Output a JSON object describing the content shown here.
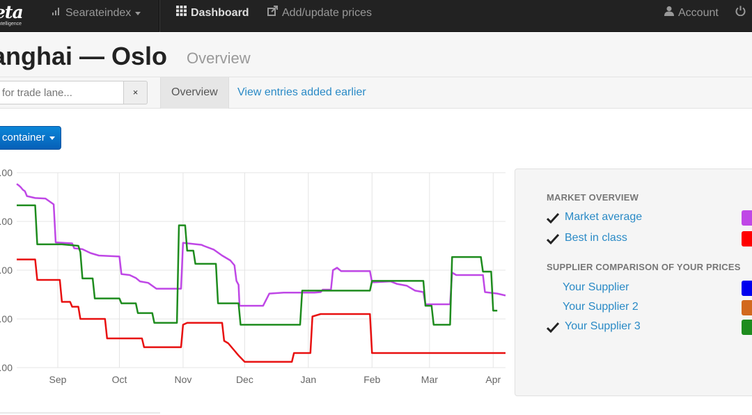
{
  "navbar": {
    "logo_text": "eta",
    "logo_sub": "intelligence",
    "index_menu": "Searateindex",
    "dashboard": "Dashboard",
    "add_prices": "Add/update prices",
    "account": "Account"
  },
  "header": {
    "title": "anghai — Oslo",
    "subtitle": "Overview"
  },
  "filter": {
    "search_placeholder": "for trade lane...",
    "clear_label": "×"
  },
  "tabs": {
    "overview": "Overview",
    "earlier": "View entries added earlier"
  },
  "container_button": "container",
  "chart_data": {
    "type": "line",
    "x_tick_labels": [
      "Sep",
      "Oct",
      "Nov",
      "Dec",
      "Jan",
      "Feb",
      "Mar",
      "Apr"
    ],
    "y_tick_labels": [
      ".00",
      ".00",
      ".00",
      ".00",
      ".00"
    ],
    "x_range_days": [
      0,
      238
    ],
    "y_range": [
      0,
      4
    ],
    "grid": true,
    "series": [
      {
        "name": "Market average",
        "color": "#bf47e6",
        "points": [
          [
            0,
            3.77
          ],
          [
            1,
            3.74
          ],
          [
            2,
            3.7
          ],
          [
            3,
            3.65
          ],
          [
            4,
            3.62
          ],
          [
            5,
            3.52
          ],
          [
            9,
            3.48
          ],
          [
            14,
            3.47
          ],
          [
            18,
            3.35
          ],
          [
            19,
            2.57
          ],
          [
            27,
            2.55
          ],
          [
            28,
            2.45
          ],
          [
            32,
            2.43
          ],
          [
            36,
            2.35
          ],
          [
            40,
            2.3
          ],
          [
            50,
            2.28
          ],
          [
            51,
            1.92
          ],
          [
            55,
            1.9
          ],
          [
            58,
            1.84
          ],
          [
            60,
            1.77
          ],
          [
            64,
            1.74
          ],
          [
            68,
            1.62
          ],
          [
            80,
            1.62
          ],
          [
            81,
            2.56
          ],
          [
            90,
            2.52
          ],
          [
            91,
            2.5
          ],
          [
            96,
            2.42
          ],
          [
            100,
            2.3
          ],
          [
            104,
            2.2
          ],
          [
            106,
            2.1
          ],
          [
            107,
            1.78
          ],
          [
            108,
            1.7
          ],
          [
            108.5,
            1.27
          ],
          [
            120,
            1.27
          ],
          [
            123,
            1.52
          ],
          [
            130,
            1.54
          ],
          [
            145,
            1.54
          ],
          [
            148,
            1.55
          ],
          [
            149,
            1.6
          ],
          [
            153,
            1.6
          ],
          [
            154,
            2.0
          ],
          [
            156,
            2.05
          ],
          [
            158,
            1.98
          ],
          [
            172,
            1.98
          ],
          [
            173,
            1.75
          ],
          [
            182,
            1.77
          ],
          [
            185,
            1.72
          ],
          [
            190,
            1.68
          ],
          [
            194,
            1.58
          ],
          [
            198,
            1.55
          ],
          [
            199,
            1.3
          ],
          [
            211,
            1.3
          ],
          [
            212,
            1.95
          ],
          [
            214,
            1.9
          ],
          [
            227,
            1.9
          ],
          [
            228,
            1.55
          ],
          [
            234,
            1.52
          ],
          [
            238,
            1.48
          ]
        ]
      },
      {
        "name": "Best in class",
        "color": "#e81010",
        "points": [
          [
            0,
            2.22
          ],
          [
            9,
            2.22
          ],
          [
            10,
            1.8
          ],
          [
            21,
            1.8
          ],
          [
            22,
            1.35
          ],
          [
            26,
            1.35
          ],
          [
            27,
            1.25
          ],
          [
            30,
            1.25
          ],
          [
            31,
            1.0
          ],
          [
            43,
            1.0
          ],
          [
            44,
            0.6
          ],
          [
            61,
            0.6
          ],
          [
            62,
            0.42
          ],
          [
            80,
            0.42
          ],
          [
            81,
            0.88
          ],
          [
            83,
            0.92
          ],
          [
            100,
            0.92
          ],
          [
            101,
            0.55
          ],
          [
            103,
            0.5
          ],
          [
            106,
            0.35
          ],
          [
            108,
            0.25
          ],
          [
            111,
            0.12
          ],
          [
            134,
            0.12
          ],
          [
            135,
            0.3
          ],
          [
            143,
            0.3
          ],
          [
            144,
            1.05
          ],
          [
            148,
            1.1
          ],
          [
            172,
            1.1
          ],
          [
            173,
            0.3
          ],
          [
            238,
            0.3
          ]
        ]
      },
      {
        "name": "Your Supplier 3",
        "color": "#1e8c1e",
        "points": [
          [
            0,
            3.33
          ],
          [
            9,
            3.33
          ],
          [
            10,
            2.53
          ],
          [
            22,
            2.53
          ],
          [
            30,
            2.5
          ],
          [
            31,
            2.37
          ],
          [
            32,
            1.83
          ],
          [
            37,
            1.83
          ],
          [
            38,
            1.42
          ],
          [
            50,
            1.42
          ],
          [
            51,
            1.32
          ],
          [
            58,
            1.32
          ],
          [
            59,
            1.12
          ],
          [
            66,
            1.12
          ],
          [
            67,
            0.92
          ],
          [
            78,
            0.92
          ],
          [
            79,
            2.92
          ],
          [
            82,
            2.92
          ],
          [
            83,
            2.4
          ],
          [
            86,
            2.4
          ],
          [
            87,
            2.13
          ],
          [
            97,
            2.13
          ],
          [
            98,
            1.32
          ],
          [
            108,
            1.32
          ],
          [
            109,
            0.88
          ],
          [
            138,
            0.88
          ],
          [
            139,
            1.58
          ],
          [
            172,
            1.58
          ],
          [
            173,
            1.78
          ],
          [
            198,
            1.78
          ],
          [
            199,
            1.27
          ],
          [
            202,
            1.27
          ],
          [
            203,
            0.88
          ],
          [
            211,
            0.88
          ],
          [
            212,
            2.27
          ],
          [
            226,
            2.27
          ],
          [
            227,
            1.97
          ],
          [
            231,
            1.97
          ],
          [
            232,
            1.17
          ],
          [
            234,
            1.17
          ]
        ]
      }
    ]
  },
  "legend": {
    "market_section": "MARKET OVERVIEW",
    "supplier_section": "SUPPLIER COMPARISON OF YOUR PRICES",
    "items": [
      {
        "label": "Market average",
        "checked": true,
        "color": "#bf47e6"
      },
      {
        "label": "Best in class",
        "checked": true,
        "color": "#ff0000"
      },
      {
        "label": "Your Supplier",
        "checked": false,
        "color": "#0000ee"
      },
      {
        "label": "Your Supplier 2",
        "checked": false,
        "color": "#d2691e"
      },
      {
        "label": "Your Supplier 3",
        "checked": true,
        "color": "#1e8c1e"
      }
    ]
  }
}
